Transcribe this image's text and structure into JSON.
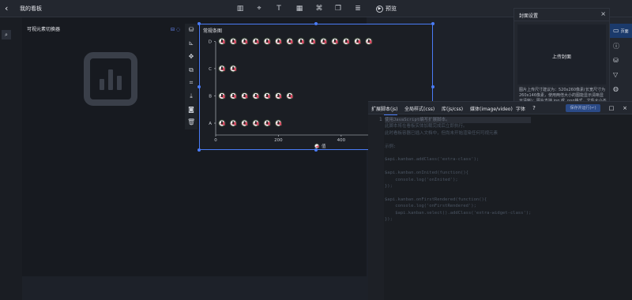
{
  "topbar": {
    "back_icon": "chevron-left-icon",
    "title": "我的看板",
    "tool_icons": [
      "bar-chart-icon",
      "map-pin-icon",
      "text-icon",
      "table-icon",
      "command-icon",
      "copy-icon",
      "layers-icon"
    ],
    "preview_label": "预览"
  },
  "canvas": {
    "switcher_title": "可视元素切换器",
    "search_icon": "search-icon",
    "placeholder_icon": "bar-chart-placeholder-icon"
  },
  "chart_toolbar": {
    "icons": [
      "database-icon",
      "chart-axis-icon",
      "move-icon",
      "duplicate-icon",
      "crop-icon",
      "download-icon",
      "camera-icon",
      "trash-icon"
    ]
  },
  "chart_data": {
    "type": "scatter",
    "title": "常规条图",
    "categories": [
      "A",
      "B",
      "C",
      "D"
    ],
    "x_ticks": [
      0,
      200,
      400,
      600
    ],
    "xlim": [
      0,
      460
    ],
    "counts": [
      6,
      7,
      2,
      14
    ],
    "legend_label": "值",
    "marker_color": "#d9455f"
  },
  "properties": {
    "title": "封面设置",
    "upload_label": "上传封面",
    "description": "图片上传尺寸建议为：520x260像素(长宽尺寸为260x146像素，使用两倍大小的图能显示清晰显示清晰)；图片支持.jpg 或 .png格式，文件大小不大于300KB。"
  },
  "sidetabs": [
    {
      "icon": "monitor-icon",
      "label": "页面"
    },
    {
      "icon": "info-icon",
      "label": ""
    },
    {
      "icon": "database-icon",
      "label": ""
    },
    {
      "icon": "filter-icon",
      "label": ""
    },
    {
      "icon": "palette-icon",
      "label": ""
    }
  ],
  "editor": {
    "tabs": [
      "扩展脚本(js)",
      "全局样式(css)",
      "库(js/css)",
      "媒体(image/video)",
      "字体"
    ],
    "help_icon": "help-icon",
    "run_button": "保存并运行(↵)",
    "expand_icon": "maximize-icon",
    "close_icon": "close-icon",
    "line_number": "1",
    "code_lines": [
      "使用JavaScript编写扩展脚本。",
      "此脚本将在看板实体加载完成后立即执行。",
      "此时看板容器已插入文档中，但尚未开始渲染任何可视元素",
      "",
      "示例:",
      "",
      "$api.kanban.addClass('extra-class');",
      "",
      "$api.kanban.onInited(function(){",
      "    console.log('onInited');",
      "});",
      "",
      "$api.kanban.onFirstRendered(function(){",
      "    console.log('onFirstRendered');",
      "    $api.kanban.select().addClass('extra-widget-class');",
      "});"
    ]
  }
}
